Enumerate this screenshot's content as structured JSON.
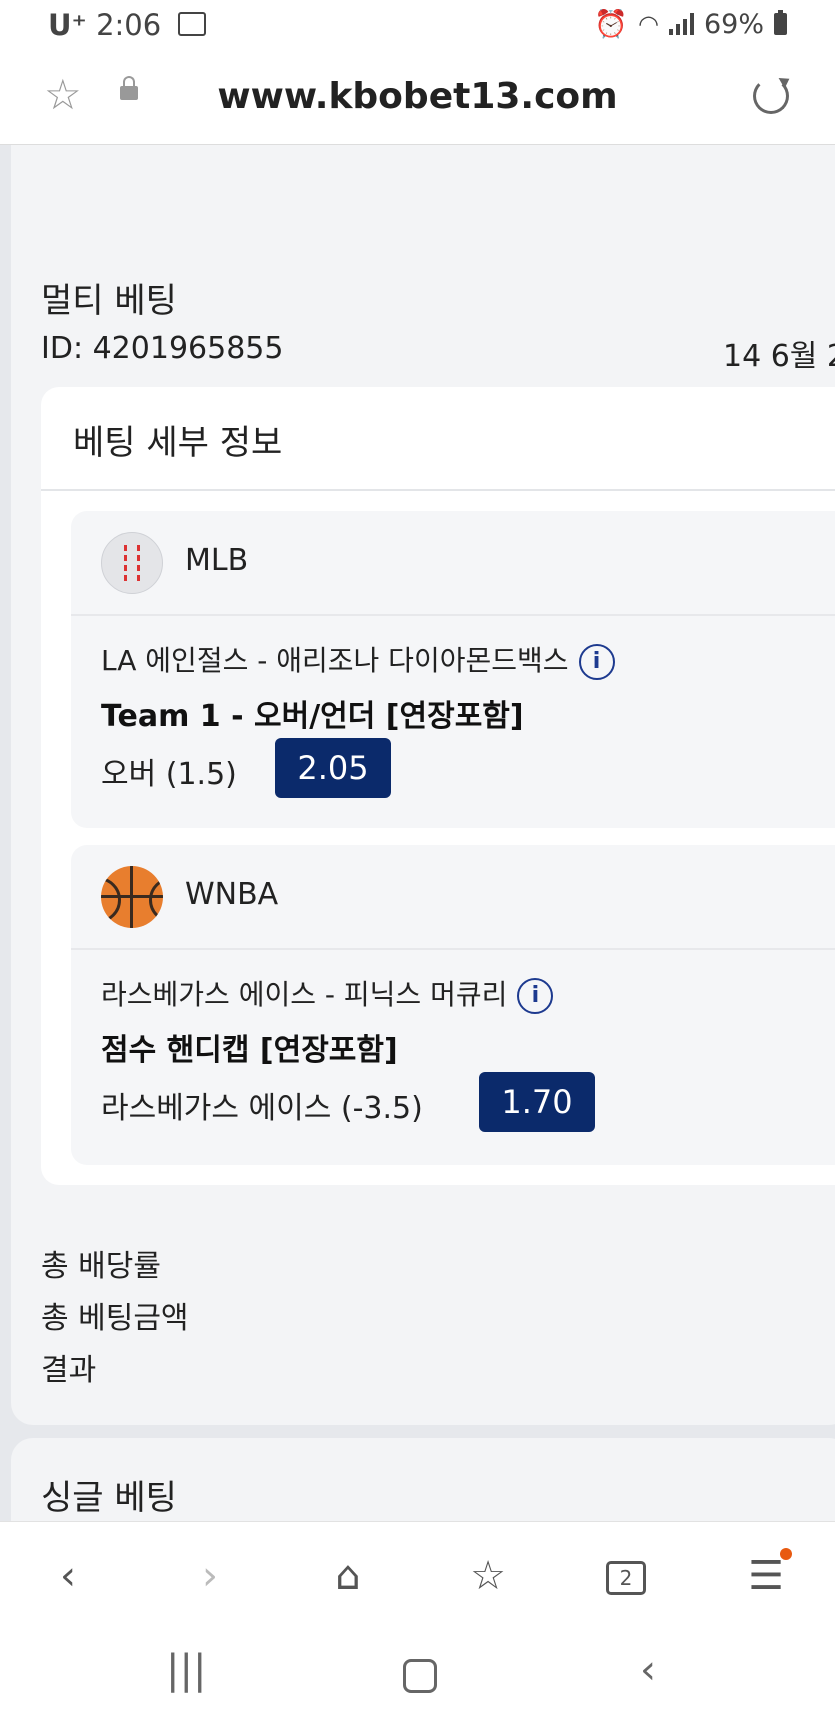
{
  "status_bar": {
    "carrier": "U⁺",
    "time": "2:06",
    "battery": "69%"
  },
  "browser": {
    "url": "www.kbobet13.com"
  },
  "previous_card": {
    "result_label": "결과"
  },
  "multi_bet": {
    "title": "멀티 베팅",
    "id_text": "ID: 4201965855",
    "date_text": "14 6월 2",
    "details_title": "베팅 세부 정보",
    "bets": [
      {
        "sport": "MLB",
        "icon": "baseball-icon",
        "match": "LA 에인절스 - 애리조나 다이아몬드백스",
        "market": "Team 1 - 오버/언더 [연장포함]",
        "selection": "오버 (1.5)",
        "odds": "2.05"
      },
      {
        "sport": "WNBA",
        "icon": "basketball-icon",
        "match": "라스베가스 에이스 - 피닉스 머큐리",
        "market": "점수 핸디캡 [연장포함]",
        "selection": "라스베가스 에이스 (-3.5)",
        "odds": "1.70"
      }
    ],
    "total_odds_label": "총 배당률",
    "total_stake_label": "총 베팅금액",
    "result_label": "결과"
  },
  "single_bet": {
    "title": "싱글 베팅"
  },
  "nav": {
    "tabs_count": "2"
  },
  "colors": {
    "odds_bg": "#0b2a6b",
    "info_icon": "#1d3a8f",
    "live_dot": "#e8323c",
    "menu_badge": "#e85a10"
  }
}
